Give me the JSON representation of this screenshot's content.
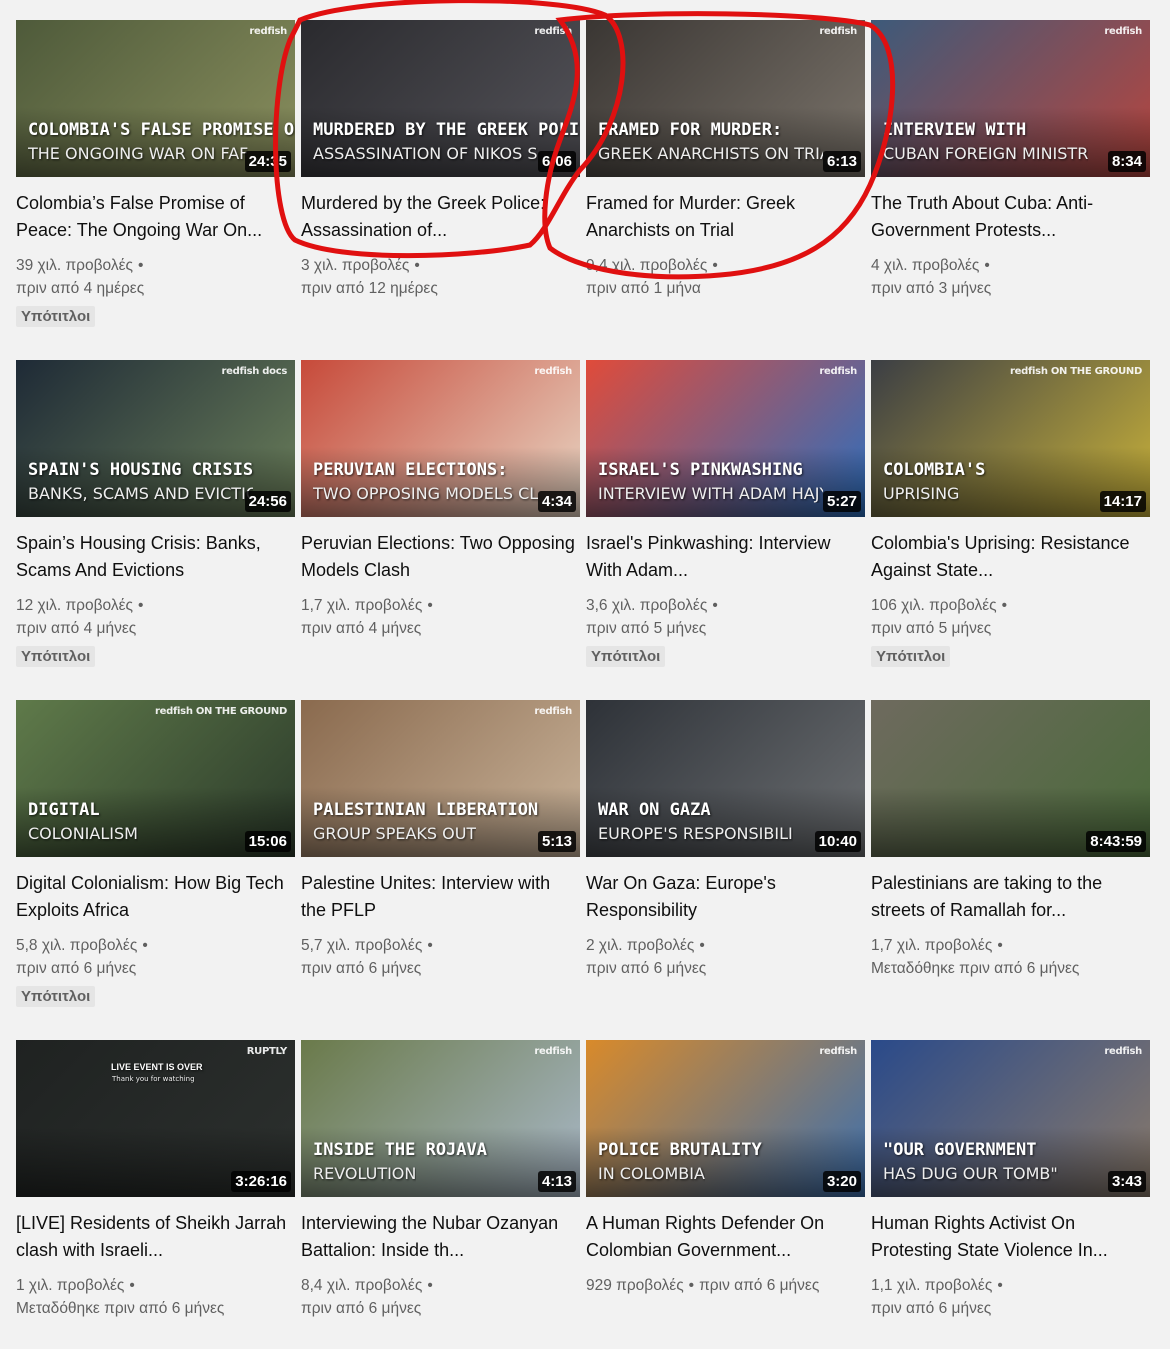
{
  "videos": [
    {
      "title": "Colombia’s False Promise of Peace: The Ongoing War On...",
      "views": "39 χιλ. προβολές",
      "age": "πριν από 4 ημέρες",
      "duration": "24:35",
      "badge": "Υπότιτλοι",
      "overlay1": "COLOMBIA'S FALSE PROMISE OF PEACE",
      "overlay2": "THE ONGOING WAR ON FAF",
      "brand": "redfish",
      "colors": [
        "#4e5a3a",
        "#8a8f5e"
      ]
    },
    {
      "title": "Murdered by the Greek Police: Assassination of...",
      "views": "3 χιλ. προβολές",
      "age": "πριν από 12 ημέρες",
      "duration": "6:06",
      "badge": "",
      "overlay1": "MURDERED BY THE GREEK POLICE",
      "overlay2": "ASSASSINATION OF NIKOS SABANIS",
      "brand": "redfish",
      "colors": [
        "#2a2a2e",
        "#55545a"
      ]
    },
    {
      "title": "Framed for Murder: Greek Anarchists on Trial",
      "views": "9,4 χιλ. προβολές",
      "age": "πριν από 1 μήνα",
      "duration": "6:13",
      "badge": "",
      "overlay1": "FRAMED FOR MURDER:",
      "overlay2": "GREEK ANARCHISTS ON TRIA",
      "brand": "redfish",
      "colors": [
        "#3a3633",
        "#7b746b"
      ]
    },
    {
      "title": "The Truth About Cuba: Anti-Government Protests...",
      "views": "4 χιλ. προβολές",
      "age": "πριν από 3 μήνες",
      "duration": "8:34",
      "badge": "",
      "overlay1": "INTERVIEW WITH",
      "overlay2": "CUBAN FOREIGN MINISTR",
      "brand": "redfish",
      "colors": [
        "#3d5a7a",
        "#b8453e"
      ]
    },
    {
      "title": "Spain’s Housing Crisis: Banks, Scams And Evictions",
      "views": "12 χιλ. προβολές",
      "age": "πριν από 4 μήνες",
      "duration": "24:56",
      "badge": "Υπότιτλοι",
      "overlay1": "SPAIN'S HOUSING CRISIS",
      "overlay2": "BANKS, SCAMS AND EVICTIO",
      "brand": "redfish docs",
      "colors": [
        "#1e2a36",
        "#6b7f5a"
      ]
    },
    {
      "title": "Peruvian Elections: Two Opposing Models Clash",
      "views": "1,7 χιλ. προβολές",
      "age": "πριν από 4 μήνες",
      "duration": "4:34",
      "badge": "",
      "overlay1": "PERUVIAN ELECTIONS:",
      "overlay2": "TWO OPPOSING MODELS CL",
      "brand": "redfish",
      "colors": [
        "#c74a3a",
        "#e8d6c4"
      ]
    },
    {
      "title": "Israel's Pinkwashing: Interview With Adam...",
      "views": "3,6 χιλ. προβολές",
      "age": "πριν από 5 μήνες",
      "duration": "5:27",
      "badge": "Υπότιτλοι",
      "overlay1": "ISRAEL'S PINKWASHING",
      "overlay2": "INTERVIEW WITH ADAM HAJYAHI",
      "brand": "redfish",
      "colors": [
        "#e04b3a",
        "#2a6fc0"
      ]
    },
    {
      "title": "Colombia's Uprising: Resistance Against State...",
      "views": "106 χιλ. προβολές",
      "age": "πριν από 5 μήνες",
      "duration": "14:17",
      "badge": "Υπότιτλοι",
      "overlay1": "COLOMBIA'S",
      "overlay2": "UPRISING",
      "brand": "redfish ON THE GROUND",
      "colors": [
        "#3b3e44",
        "#c9b23a"
      ]
    },
    {
      "title": "Digital Colonialism: How Big Tech Exploits Africa",
      "views": "5,8 χιλ. προβολές",
      "age": "πριν από 6 μήνες",
      "duration": "15:06",
      "badge": "Υπότιτλοι",
      "overlay1": "DIGITAL",
      "overlay2": "COLONIALISM",
      "brand": "redfish ON THE GROUND",
      "colors": [
        "#5f7a4a",
        "#2b3a2a"
      ]
    },
    {
      "title": "Palestine Unites: Interview with the PFLP",
      "views": "5,7 χιλ. προβολές",
      "age": "πριν από 6 μήνες",
      "duration": "5:13",
      "badge": "",
      "overlay1": "PALESTINIAN LIBERATION",
      "overlay2": "GROUP SPEAKS OUT",
      "brand": "redfish",
      "colors": [
        "#8a6a4e",
        "#c9b39a"
      ]
    },
    {
      "title": "War On Gaza: Europe's Responsibility",
      "views": "2 χιλ. προβολές",
      "age": "πριν από 6 μήνες",
      "duration": "10:40",
      "badge": "",
      "overlay1": "WAR ON GAZA",
      "overlay2": "EUROPE'S RESPONSIBILI",
      "brand": "",
      "colors": [
        "#2e3238",
        "#6c6f72"
      ]
    },
    {
      "title": "Palestinians are taking to the streets of Ramallah for...",
      "views": "1,7 χιλ. προβολές",
      "age": "Μεταδόθηκε πριν από 6 μήνες",
      "duration": "8:43:59",
      "badge": "",
      "overlay1": "",
      "overlay2": "",
      "brand": "",
      "colors": [
        "#6e6a5e",
        "#4a6a3a"
      ]
    },
    {
      "title": "[LIVE] Residents of Sheikh Jarrah clash with Israeli...",
      "views": "1 χιλ. προβολές",
      "age": "Μεταδόθηκε πριν από 6 μήνες",
      "duration": "3:26:16",
      "badge": "",
      "overlay1": "LIVE EVENT IS OVER",
      "overlay2": "Thank you for watching",
      "brand": "RUPTLY",
      "colors": [
        "#1f2221",
        "#2c302e"
      ]
    },
    {
      "title": "Interviewing the Nubar Ozanyan Battalion: Inside th...",
      "views": "8,4 χιλ. προβολές",
      "age": "πριν από 6 μήνες",
      "duration": "4:13",
      "badge": "",
      "overlay1": "INSIDE THE ROJAVA",
      "overlay2": "REVOLUTION",
      "brand": "redfish",
      "colors": [
        "#6a7a4a",
        "#a9b8c8"
      ]
    },
    {
      "title": "A Human Rights Defender On Colombian Government...",
      "views": "929 προβολές",
      "age": "πριν από 6 μήνες",
      "duration": "3:20",
      "badge": "",
      "overlay1": "POLICE BRUTALITY",
      "overlay2": "IN COLOMBIA",
      "brand": "redfish",
      "colors": [
        "#d98a2a",
        "#3a6fb0"
      ]
    },
    {
      "title": "Human Rights Activist On Protesting State Violence In...",
      "views": "1,1 χιλ. προβολές",
      "age": "πριν από 6 μήνες",
      "duration": "3:43",
      "badge": "",
      "overlay1": "\"OUR GOVERNMENT",
      "overlay2": "HAS DUG OUR TOMB\"",
      "brand": "redfish",
      "colors": [
        "#2a4a8a",
        "#8a7a6a"
      ]
    }
  ],
  "separator": "•",
  "annotation_color": "#e01010"
}
